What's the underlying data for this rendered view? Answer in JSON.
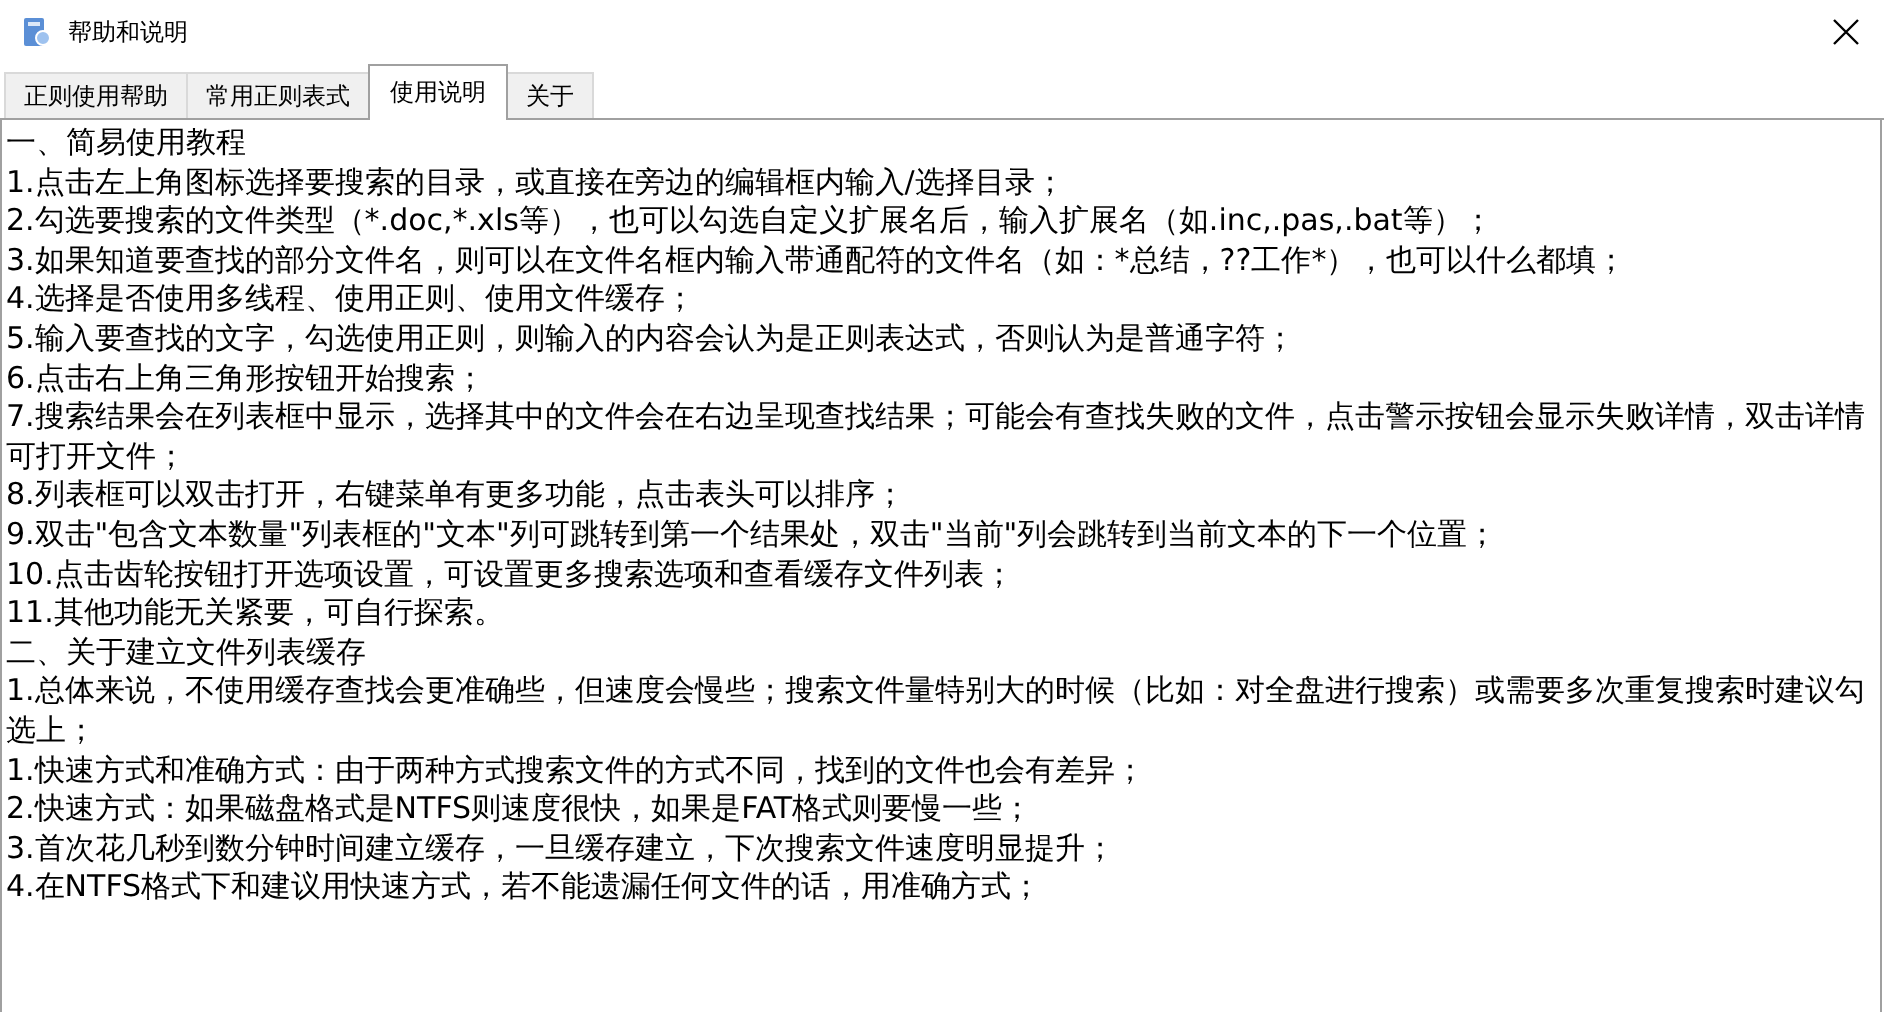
{
  "window": {
    "title": "帮助和说明"
  },
  "tabs": [
    {
      "label": "正则使用帮助",
      "selected": false
    },
    {
      "label": "常用正则表式",
      "selected": false
    },
    {
      "label": "使用说明",
      "selected": true
    },
    {
      "label": "关于",
      "selected": false
    }
  ],
  "content": {
    "lines": [
      "一、简易使用教程",
      "1.点击左上角图标选择要搜索的目录，或直接在旁边的编辑框内输入/选择目录；",
      "2.勾选要搜索的文件类型（*.doc,*.xls等），也可以勾选自定义扩展名后，输入扩展名（如.inc,.pas,.bat等）；",
      "3.如果知道要查找的部分文件名，则可以在文件名框内输入带通配符的文件名（如：*总结，??工作*），也可以什么都填；",
      "4.选择是否使用多线程、使用正则、使用文件缓存；",
      "5.输入要查找的文字，勾选使用正则，则输入的内容会认为是正则表达式，否则认为是普通字符；",
      "6.点击右上角三角形按钮开始搜索；",
      "7.搜索结果会在列表框中显示，选择其中的文件会在右边呈现查找结果；可能会有查找失败的文件，点击警示按钮会显示失败详情，双击详情可打开文件；",
      "8.列表框可以双击打开，右键菜单有更多功能，点击表头可以排序；",
      "9.双击\"包含文本数量\"列表框的\"文本\"列可跳转到第一个结果处，双击\"当前\"列会跳转到当前文本的下一个位置；",
      "10.点击齿轮按钮打开选项设置，可设置更多搜索选项和查看缓存文件列表；",
      "11.其他功能无关紧要，可自行探索。",
      "二、关于建立文件列表缓存",
      "1.总体来说，不使用缓存查找会更准确些，但速度会慢些；搜索文件量特别大的时候（比如：对全盘进行搜索）或需要多次重复搜索时建议勾选上；",
      "1.快速方式和准确方式：由于两种方式搜索文件的方式不同，找到的文件也会有差异；",
      "2.快速方式：如果磁盘格式是NTFS则速度很快，如果是FAT格式则要慢一些；",
      "3.首次花几秒到数分钟时间建立缓存，一旦缓存建立，下次搜索文件速度明显提升；",
      "4.在NTFS格式下和建议用快速方式，若不能遗漏任何文件的话，用准确方式；"
    ]
  }
}
